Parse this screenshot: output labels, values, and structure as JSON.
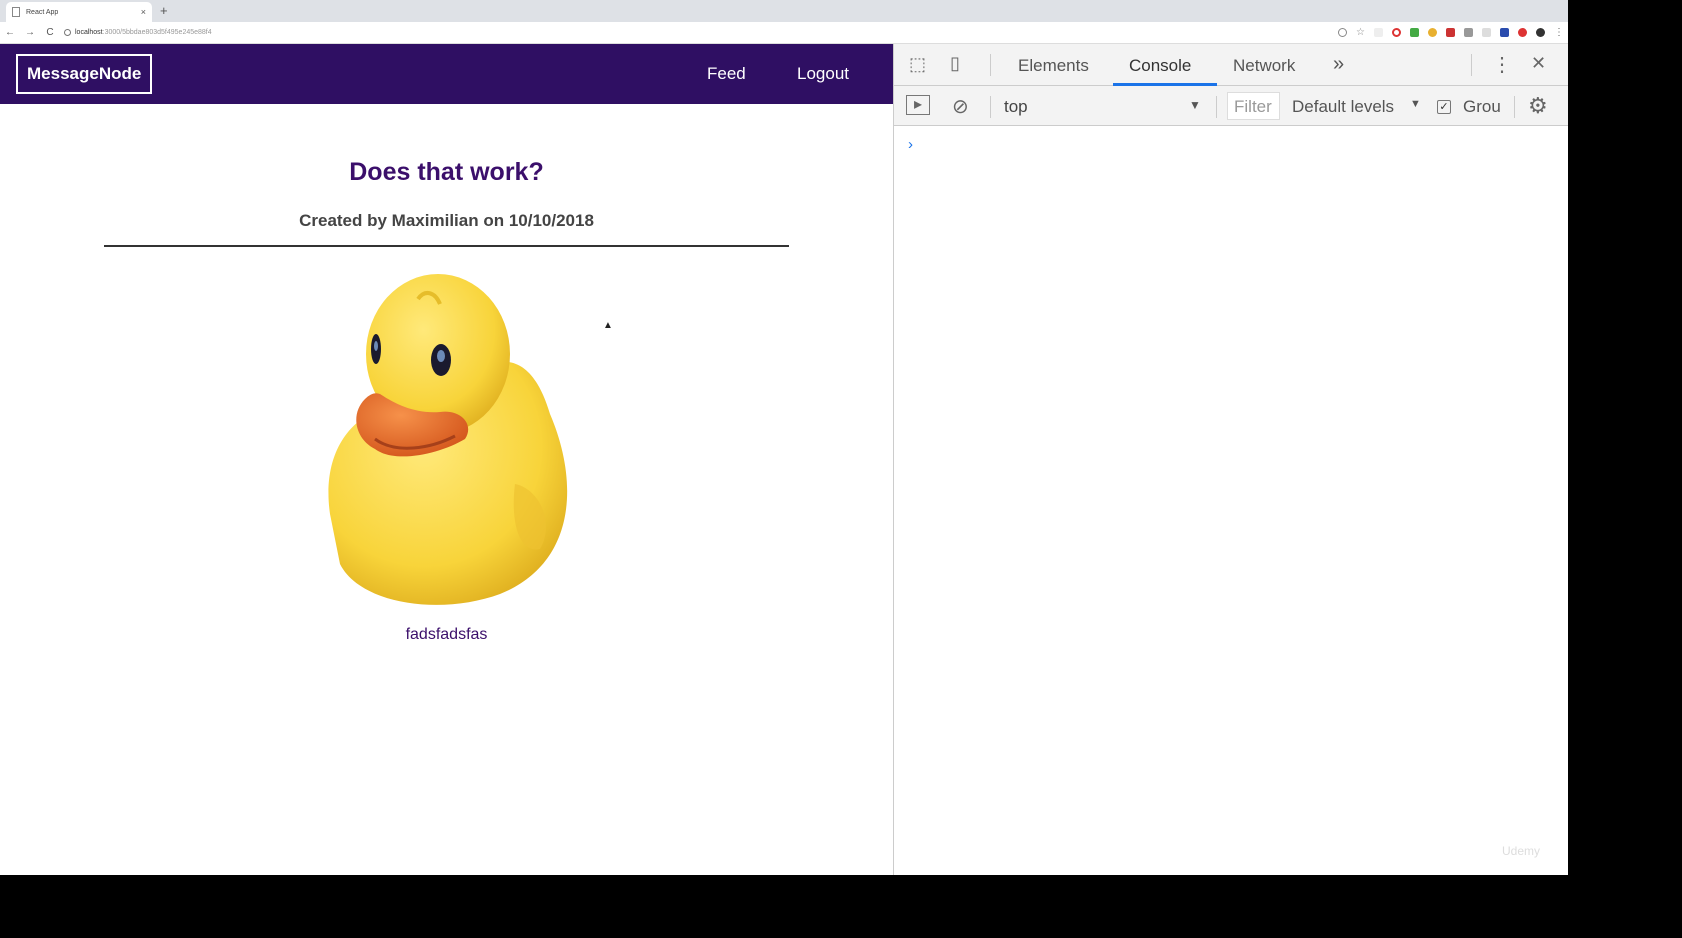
{
  "browser": {
    "tab_title": "React App",
    "tab_close": "×",
    "new_tab": "+",
    "back": "←",
    "forward": "→",
    "reload": "C",
    "url_host": "localhost",
    "url_rest": ":3000/5bbdae803d5f495e245e88f4"
  },
  "app": {
    "logo": "MessageNode",
    "nav": {
      "feed": "Feed",
      "logout": "Logout"
    },
    "post": {
      "title": "Does that work?",
      "meta": "Created by Maximilian on 10/10/2018",
      "content": "fadsfadsfas"
    }
  },
  "devtools": {
    "tabs": [
      "Elements",
      "Console",
      "Network"
    ],
    "more_tabs": "»",
    "menu": "⋮",
    "close": "✕",
    "context": "top",
    "filter_placeholder": "Filter",
    "levels": "Default levels",
    "group_label": "Grou",
    "prompt": "›"
  },
  "watermark": "Udemy",
  "colors": {
    "navbar": "#2f0f63",
    "title": "#3b0f6b",
    "accent": "#1a73e8"
  }
}
